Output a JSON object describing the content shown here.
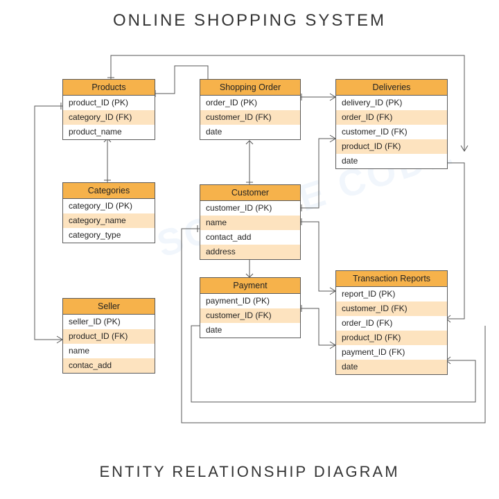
{
  "title": "ONLINE SHOPPING SYSTEM",
  "subtitle": "ENTITY RELATIONSHIP DIAGRAM",
  "entities": {
    "products": {
      "name": "Products",
      "fields": [
        "product_ID (PK)",
        "category_ID (FK)",
        "product_name"
      ]
    },
    "categories": {
      "name": "Categories",
      "fields": [
        "category_ID (PK)",
        "category_name",
        "category_type"
      ]
    },
    "seller": {
      "name": "Seller",
      "fields": [
        "seller_ID (PK)",
        "product_ID (FK)",
        "name",
        "contac_add"
      ]
    },
    "order": {
      "name": "Shopping Order",
      "fields": [
        "order_ID (PK)",
        "customer_ID (FK)",
        "date"
      ]
    },
    "customer": {
      "name": "Customer",
      "fields": [
        "customer_ID (PK)",
        "name",
        "contact_add",
        "address"
      ]
    },
    "payment": {
      "name": "Payment",
      "fields": [
        "payment_ID (PK)",
        "customer_ID (FK)",
        "date"
      ]
    },
    "deliveries": {
      "name": "Deliveries",
      "fields": [
        "delivery_ID (PK)",
        "order_ID (FK)",
        "customer_ID (FK)",
        "product_ID (FK)",
        "date"
      ]
    },
    "reports": {
      "name": "Transaction Reports",
      "fields": [
        "report_ID (PK)",
        "customer_ID (FK)",
        "order_ID (FK)",
        "product_ID (FK)",
        "payment_ID (FK)",
        "date"
      ]
    }
  },
  "relationships": [
    {
      "from": "Products.product_ID",
      "to": "Seller.product_ID"
    },
    {
      "from": "Products.product_ID",
      "to": "Shopping Order (via products)"
    },
    {
      "from": "Categories.category_ID",
      "to": "Products.category_ID"
    },
    {
      "from": "Shopping Order.order_ID",
      "to": "Deliveries.order_ID"
    },
    {
      "from": "Customer.customer_ID",
      "to": "Shopping Order.customer_ID"
    },
    {
      "from": "Customer.customer_ID",
      "to": "Deliveries.customer_ID"
    },
    {
      "from": "Customer.customer_ID",
      "to": "Payment.customer_ID"
    },
    {
      "from": "Customer.customer_ID",
      "to": "Transaction Reports.customer_ID"
    },
    {
      "from": "Payment.payment_ID",
      "to": "Transaction Reports.payment_ID"
    },
    {
      "from": "Shopping Order.order_ID",
      "to": "Transaction Reports.order_ID"
    },
    {
      "from": "Products.product_ID",
      "to": "Deliveries.product_ID"
    },
    {
      "from": "Products.product_ID",
      "to": "Transaction Reports.product_ID"
    }
  ],
  "colors": {
    "header": "#f6b24b",
    "altRow": "#fde3bf",
    "border": "#5a5a5a",
    "line": "#555555"
  }
}
